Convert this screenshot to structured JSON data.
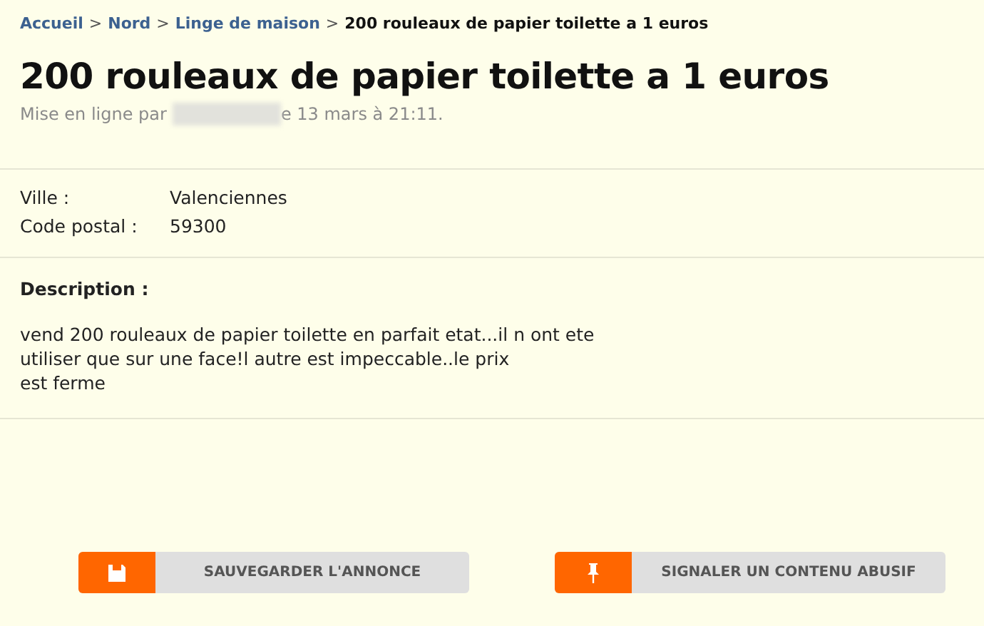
{
  "breadcrumb": [
    {
      "label": "Accueil",
      "kind": "link"
    },
    {
      "label": "Nord",
      "kind": "link"
    },
    {
      "label": "Linge de maison",
      "kind": "link"
    },
    {
      "label": "200 rouleaux de papier toilette a 1 euros",
      "kind": "current"
    }
  ],
  "breadcrumb_separator": ">",
  "title": "200 rouleaux de papier toilette a 1 euros",
  "posted": {
    "prefix": "Mise en ligne par",
    "suffix": "e 13 mars à 21:11."
  },
  "details": [
    {
      "label": "Ville :",
      "value": "Valenciennes"
    },
    {
      "label": "Code postal :",
      "value": "59300"
    }
  ],
  "description": {
    "heading": "Description :",
    "lines": [
      "vend 200 rouleaux de papier toilette en parfait etat...il n ont ete",
      "utiliser que sur une face!l autre est impeccable..le prix",
      "est ferme"
    ]
  },
  "buttons": [
    {
      "label": "SAUVEGARDER L'ANNONCE",
      "kind": "save"
    },
    {
      "label": "SIGNALER UN CONTENU ABUSIF",
      "kind": "report"
    }
  ]
}
